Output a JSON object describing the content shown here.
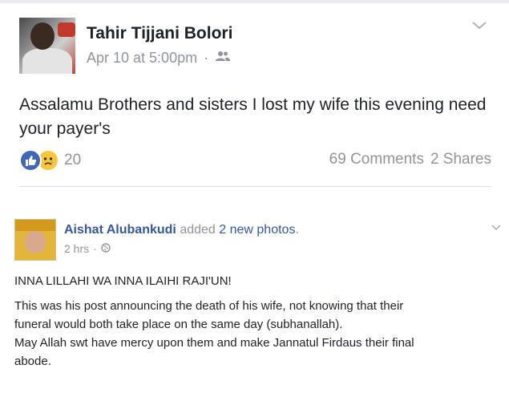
{
  "post1": {
    "author": "Tahir Tijjani Bolori",
    "timestamp": "Apr 10 at 5:00pm",
    "separator": "·",
    "privacy_icon": "friends-icon",
    "text": "Assalamu Brothers and sisters I lost my wife this evening need your payer's",
    "reaction_icons": [
      "like-icon",
      "sad-icon"
    ],
    "reaction_count": "20",
    "comments": "69 Comments",
    "shares": "2 Shares"
  },
  "post2": {
    "author": "Aishat Alubankudi",
    "action": "added",
    "photos": "2 new photos",
    "period": ".",
    "timestamp": "2 hrs",
    "separator": "·",
    "privacy_icon": "globe-icon",
    "headline": "INNA LILLAHI WA INNA ILAIHI RAJI'UN!",
    "body_lines": [
      "This was his post announcing the death of his wife, not knowing that their",
      "funeral would both take place on the same day (subhanallah).",
      "May Allah swt have mercy upon them and make Jannatul Firdaus their final",
      "abode."
    ]
  },
  "colors": {
    "link": "#365899",
    "secondary_text": "#90949c",
    "primary_text": "#1d2129",
    "like_blue": "#4267b2",
    "sad_yellow": "#f7c63d"
  }
}
